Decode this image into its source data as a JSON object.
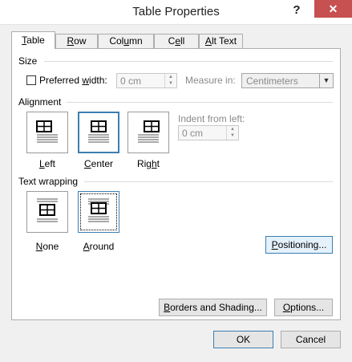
{
  "window": {
    "title": "Table Properties",
    "help_glyph": "?",
    "close_glyph": "✕"
  },
  "tabs": [
    {
      "label_u": "T",
      "label_rest": "able",
      "active": true
    },
    {
      "label_u": "R",
      "label_rest": "ow",
      "active": false
    },
    {
      "label_pre": "Col",
      "label_u": "u",
      "label_rest": "mn",
      "active": false
    },
    {
      "label_pre": "C",
      "label_u": "e",
      "label_rest": "ll",
      "active": false
    },
    {
      "label_u": "A",
      "label_rest": "lt Text",
      "active": false
    }
  ],
  "size": {
    "section_label": "Size",
    "preferred_width_pre": "Preferred ",
    "preferred_width_u": "w",
    "preferred_width_rest": "idth:",
    "preferred_width_checked": false,
    "width_value": "0 cm",
    "measure_label": "Measure in:",
    "measure_value": "Centimeters"
  },
  "alignment": {
    "section_label": "Alignment",
    "options": [
      {
        "label_u": "L",
        "label_rest": "eft",
        "selected": false
      },
      {
        "label_u": "C",
        "label_rest": "enter",
        "selected": true
      },
      {
        "label_pre": "Rig",
        "label_u": "h",
        "label_rest": "t",
        "selected": false
      }
    ],
    "indent_label": "Indent from left:",
    "indent_value": "0 cm"
  },
  "text_wrapping": {
    "section_label": "Text wrapping",
    "options": [
      {
        "label_u": "N",
        "label_rest": "one",
        "selected": false
      },
      {
        "label_u": "A",
        "label_rest": "round",
        "selected": true
      }
    ],
    "positioning_button": {
      "label_u": "P",
      "label_rest": "ositioning..."
    }
  },
  "bottom_buttons": {
    "borders": {
      "label_u": "B",
      "label_rest": "orders and Shading..."
    },
    "options": {
      "label_u": "O",
      "label_rest": "ptions..."
    }
  },
  "dialog_buttons": {
    "ok": "OK",
    "cancel": "Cancel"
  }
}
